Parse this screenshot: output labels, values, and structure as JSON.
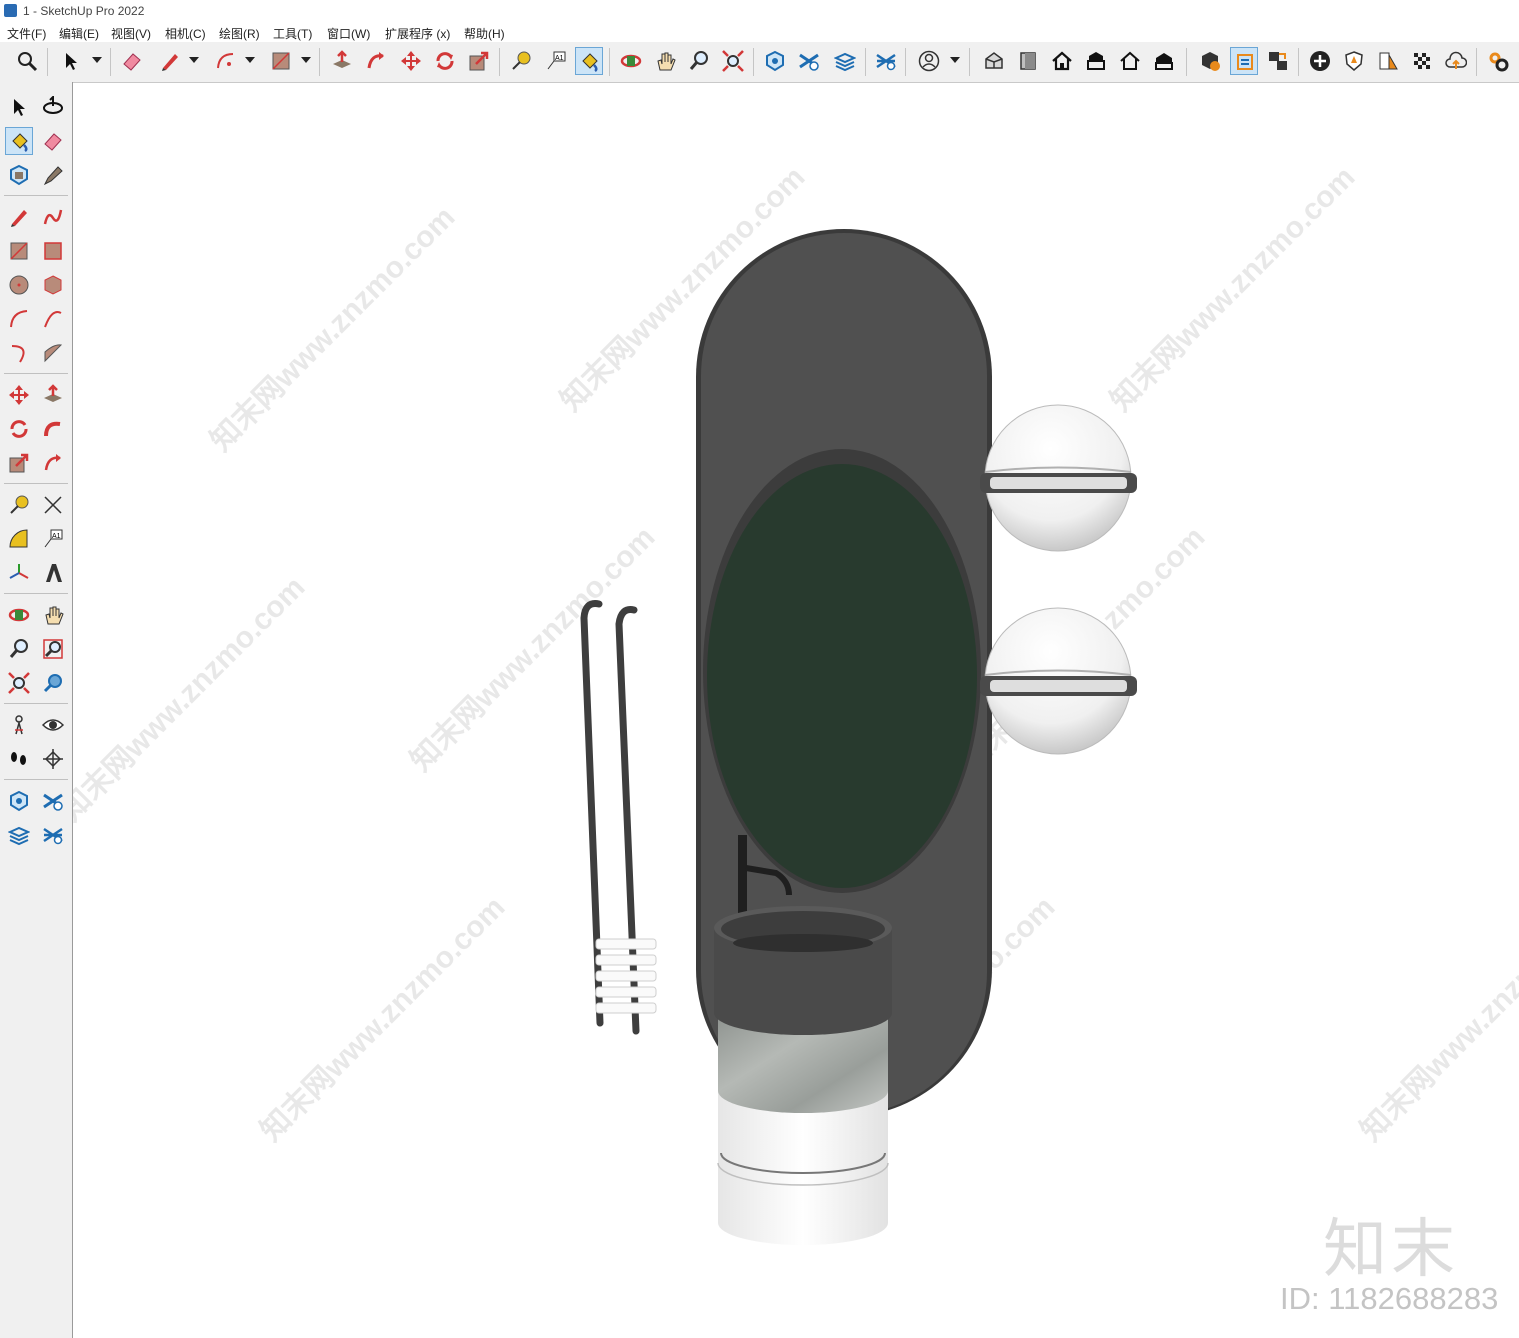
{
  "window": {
    "title": "1 - SketchUp Pro 2022"
  },
  "menu": [
    {
      "label": "文件(F)"
    },
    {
      "label": "编辑(E)"
    },
    {
      "label": "视图(V)"
    },
    {
      "label": "相机(C)"
    },
    {
      "label": "绘图(R)"
    },
    {
      "label": "工具(T)"
    },
    {
      "label": "窗口(W)"
    },
    {
      "label": "扩展程序 (x)"
    },
    {
      "label": "帮助(H)"
    }
  ],
  "toolbar": {
    "text_tool_glyph": "A1",
    "icons": [
      "search-icon",
      "select-icon",
      "eraser-icon",
      "pencil-icon",
      "arc-icon",
      "rectangle-icon",
      "push-pull-icon",
      "follow-me-icon",
      "move-icon",
      "rotate-icon",
      "scale-icon",
      "tape-measure-icon",
      "text-icon",
      "paint-bucket-icon",
      "orbit-icon",
      "pan-icon",
      "zoom-icon",
      "zoom-extents-icon",
      "component-icon",
      "layers-icon",
      "tags-icon",
      "styles-icon",
      "account-icon",
      "iso-view-icon",
      "front-view-icon",
      "home-icon",
      "back-view-icon",
      "outline-view-icon",
      "section-view-icon",
      "extension-warehouse-icon",
      "outliner-icon",
      "scenes-icon",
      "add-icon",
      "shield-icon",
      "material-icon",
      "checker-icon",
      "cloud-icon",
      "settings-icon"
    ]
  },
  "left_toolbar": {
    "text_tool_glyph": "A1",
    "icons": [
      "select-icon",
      "orbit-icon",
      "paint-bucket-icon",
      "eraser-icon",
      "component-icon",
      "tag-icon",
      "pencil-icon",
      "freehand-icon",
      "rectangle-icon",
      "rotated-rectangle-icon",
      "circle-icon",
      "polygon-icon",
      "arc-icon",
      "2-point-arc-icon",
      "pie-icon",
      "3-point-arc-icon",
      "move-icon",
      "push-pull-icon",
      "rotate-icon",
      "follow-me-icon",
      "scale-icon",
      "offset-icon",
      "tape-measure-icon",
      "dimension-icon",
      "protractor-icon",
      "text-icon",
      "axes-icon",
      "3d-text-icon",
      "orbit-icon",
      "pan-icon",
      "zoom-icon",
      "zoom-window-icon",
      "zoom-extents-icon",
      "previous-view-icon",
      "position-camera-icon",
      "look-around-icon",
      "walk-icon",
      "section-plane-icon",
      "component-icon",
      "layers-icon",
      "tags-icon",
      "styles-icon"
    ]
  },
  "watermark": {
    "text": "知末网www.znzmo.com",
    "brand": "知末",
    "id": "ID: 1182688283"
  },
  "colors": {
    "accent": "#cce4f7",
    "mirror_frame": "#505050",
    "mirror_glass": "#283a2e"
  }
}
